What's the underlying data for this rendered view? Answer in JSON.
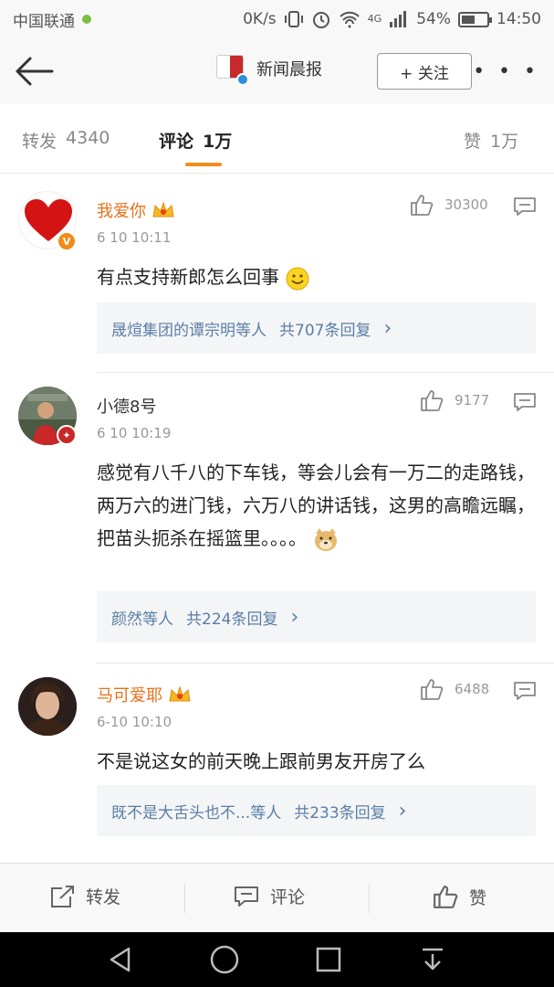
{
  "status_bar": {
    "carrier": "中国联通",
    "speed": "0K/s",
    "network": "4G",
    "battery_percent": "54%",
    "battery_level": 0.54,
    "time": "14:50"
  },
  "nav": {
    "title": "新闻晨报",
    "follow_label": "+ 关注",
    "more_label": "• • •"
  },
  "tabs": [
    {
      "label": "转发",
      "count": "4340"
    },
    {
      "label": "评论",
      "count": "1万"
    },
    {
      "label": "赞",
      "count": "1万"
    }
  ],
  "comments": [
    {
      "name": "我爱你",
      "time": "6 10 10:11",
      "likes": "30300",
      "text": "有点支持新郎怎么回事",
      "reply_names": "晟煊集团的谭宗明等人",
      "reply_count": "共707条回复",
      "reply_arrow": "›"
    },
    {
      "name": "小德8号",
      "time": "6 10 10:19",
      "likes": "9177",
      "text": "感觉有八千八的下车钱，等会儿会有一万二的走路钱，两万六的进门钱，六万八的讲话钱，这男的高瞻远瞩，把苗头扼杀在摇篮里。。。。",
      "reply_names": "颜然等人",
      "reply_count": "共224条回复",
      "reply_arrow": "›"
    },
    {
      "name": "马可爱耶",
      "time": "6-10 10:10",
      "likes": "6488",
      "text": "不是说这女的前天晚上跟前男友开房了么",
      "reply_names": "既不是大舌头也不...等人",
      "reply_count": "共233条回复",
      "reply_arrow": "›"
    }
  ],
  "actions": {
    "repost": "转发",
    "comment": "评论",
    "like": "赞"
  },
  "colors": {
    "vip_name": "#e8701a",
    "link": "#5a7ea6",
    "accent": "#f08c1a"
  }
}
